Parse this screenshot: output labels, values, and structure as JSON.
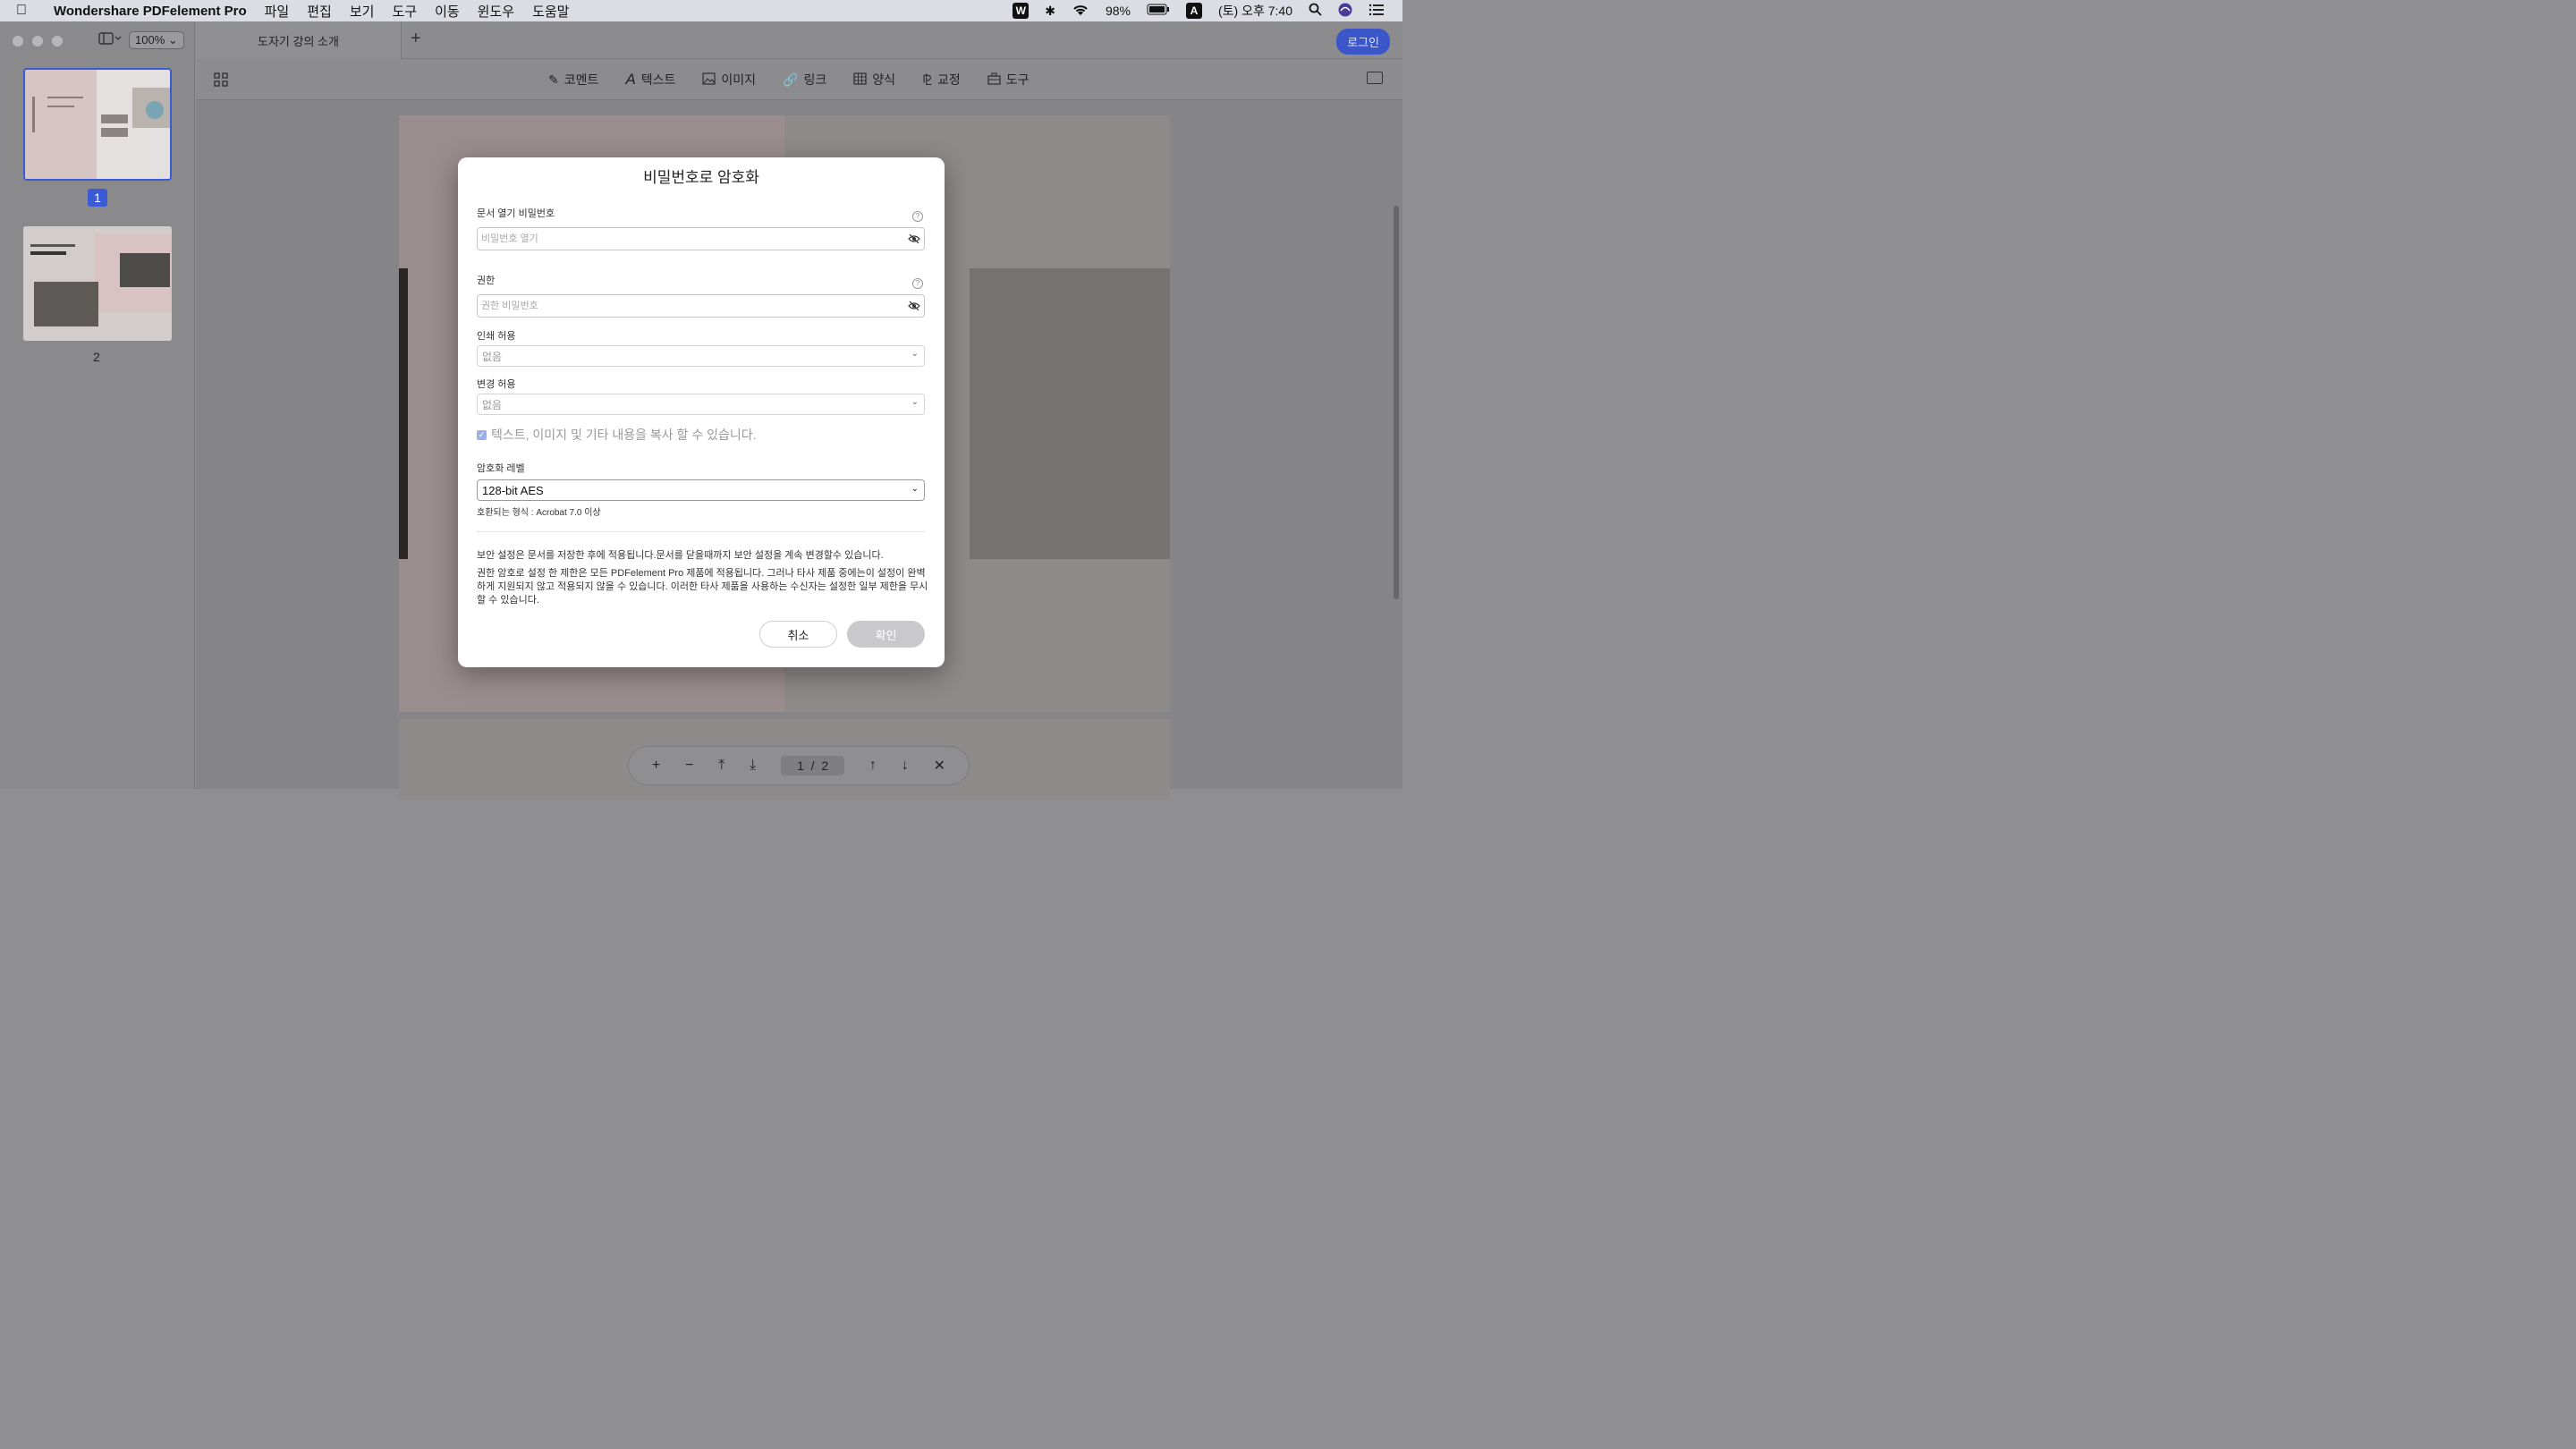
{
  "menubar": {
    "app_name": "Wondershare PDFelement Pro",
    "items": [
      "파일",
      "편집",
      "보기",
      "도구",
      "이동",
      "윈도우",
      "도움말"
    ],
    "battery": "98%",
    "input_source": "A",
    "clock": "(토) 오후 7:40"
  },
  "sidebar": {
    "zoom": "100%",
    "pages": [
      "1",
      "2"
    ]
  },
  "tabs": {
    "doc_title": "도자기 강의 소개",
    "login": "로그인"
  },
  "toolbar": {
    "comment": "코멘트",
    "text": "텍스트",
    "image": "이미지",
    "link": "링크",
    "form": "양식",
    "redact": "교정",
    "tools": "도구"
  },
  "nav": {
    "current_page": "1",
    "separator": "/",
    "total_pages": "2"
  },
  "dialog": {
    "title": "비밀번호로 암호화",
    "open_password_label": "문서 열기 비밀번호",
    "open_password_placeholder": "비밀번호 열기",
    "permission_label": "권한",
    "permission_placeholder": "권한 비밀번호",
    "print_label": "인쇄 허용",
    "print_value": "없음",
    "change_label": "변경 허용",
    "change_value": "없음",
    "copy_checkbox": "텍스트, 이미지 및 기타 내용을 복사 할 수 있습니다.",
    "enc_level_label": "암호화 레벨",
    "enc_level_value": "128-bit AES",
    "compat": "호환되는 형식 : Acrobat 7.0 이상",
    "note1": "보안 설정은 문서를 저장한 후에 적용됩니다.문서를 닫을때까지 보안 설정을 계속 변경할수 있습니다.",
    "note2": "권한 암호로 설정 한 제한은 모든 PDFelement Pro 제품에 적용됩니다. 그러나 타사 제품 중에는이 설정이 완벽하게 지원되지 않고 적용되지 않을 수 있습니다. 이러한 타사 제품을 사용하는 수신자는 설정한 일부 제한을 무시할 수 있습니다.",
    "cancel": "취소",
    "confirm": "확인"
  },
  "colors": {
    "accent": "#3b5bd6",
    "dialog_bg": "#ffffff",
    "disabled_button": "#c9c9cb"
  }
}
